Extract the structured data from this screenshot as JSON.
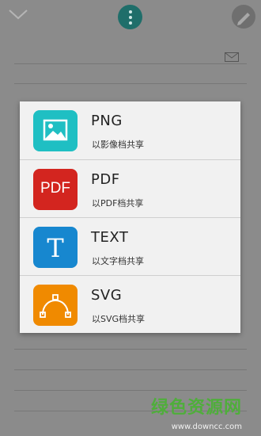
{
  "share_options": [
    {
      "label": "PNG",
      "sub": "以影像档共享"
    },
    {
      "label": "PDF",
      "sub": "以PDF档共享",
      "icon_text": "PDF"
    },
    {
      "label": "TEXT",
      "sub": "以文字档共享",
      "icon_text": "T"
    },
    {
      "label": "SVG",
      "sub": "以SVG档共享"
    }
  ],
  "watermark": {
    "text": "绿色资源网",
    "url": "www.downcc.com"
  },
  "colors": {
    "png_icon": "#1fbfc3",
    "pdf_icon": "#d3251f",
    "text_icon": "#1787cf",
    "svg_icon": "#f08a00",
    "menu_button": "#1f6e6a"
  }
}
